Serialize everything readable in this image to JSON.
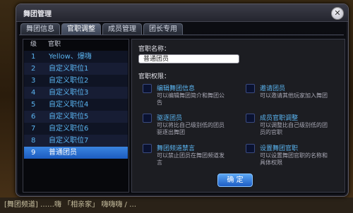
{
  "window": {
    "title": "舞团管理",
    "close_label": "✕"
  },
  "tabs": [
    {
      "label": "舞团信息"
    },
    {
      "label": "官职调整"
    },
    {
      "label": "成员管理"
    },
    {
      "label": "团长专用"
    }
  ],
  "active_tab": 1,
  "rank_list": {
    "headers": {
      "level": "级别",
      "title": "官职"
    },
    "rows": [
      {
        "level": "1",
        "title": "Yellow、爆嗨"
      },
      {
        "level": "2",
        "title": "自定义职位1"
      },
      {
        "level": "3",
        "title": "自定义职位2"
      },
      {
        "level": "4",
        "title": "自定义职位3"
      },
      {
        "level": "5",
        "title": "自定义职位4"
      },
      {
        "level": "6",
        "title": "自定义职位5"
      },
      {
        "level": "7",
        "title": "自定义职位6"
      },
      {
        "level": "8",
        "title": "自定义职位7"
      },
      {
        "level": "9",
        "title": "普通团员"
      }
    ],
    "selected_index": 8
  },
  "detail": {
    "name_label": "官职名称：",
    "name_value": "普通团员",
    "perm_label": "官职权限：",
    "permissions": [
      {
        "title": "编辑舞团信息",
        "desc": "可以编辑舞团简介和舞团公告",
        "checked": false
      },
      {
        "title": "邀请团员",
        "desc": "可以邀请其他玩家加入舞团",
        "checked": false
      },
      {
        "title": "驱逐团员",
        "desc": "可以将比自己级别低的团员驱逐出舞团",
        "checked": false
      },
      {
        "title": "成员官职调整",
        "desc": "可以调整比自己级别低的团员的官职",
        "checked": false
      },
      {
        "title": "舞团频道禁言",
        "desc": "可以禁止团员在舞团频道发言",
        "checked": false
      },
      {
        "title": "设置舞团官职",
        "desc": "可以设置舞团官职的名称和具体权限",
        "checked": false
      }
    ],
    "confirm_label": "确 定"
  },
  "background": {
    "chat_text": "[舞团频道] ……嗨 「相亲家」 嗨嗨嗨 / …"
  }
}
